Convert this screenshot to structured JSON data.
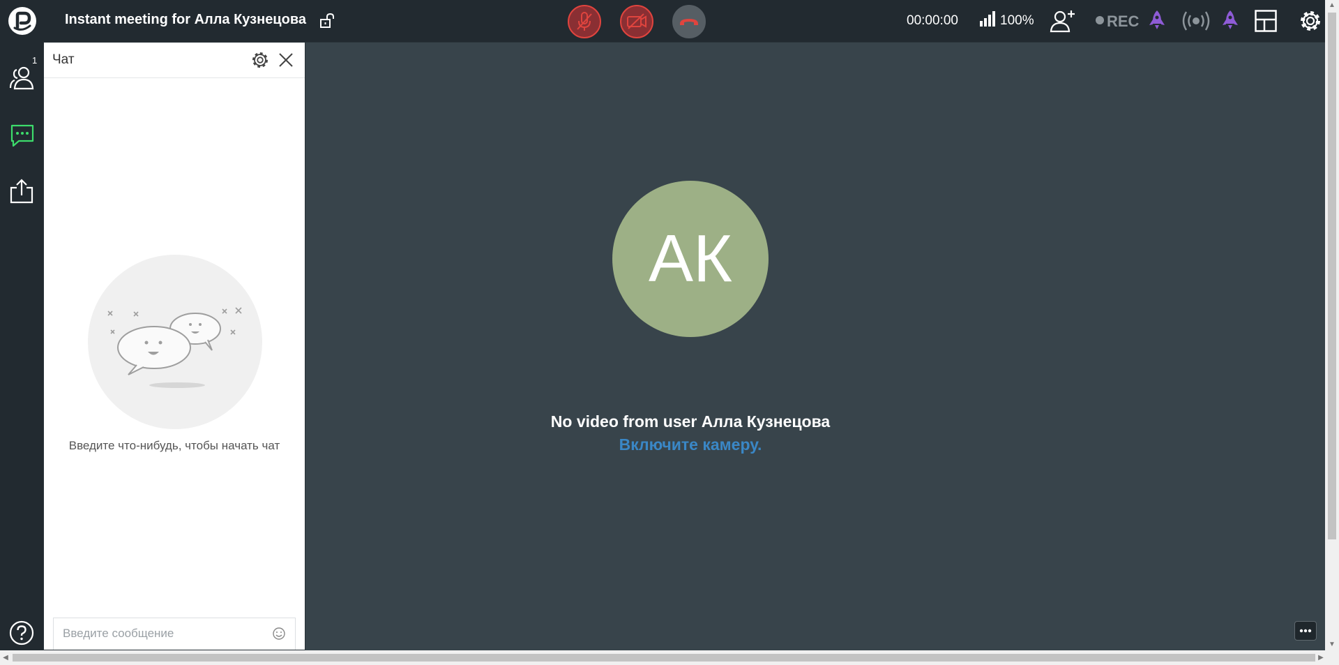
{
  "header": {
    "meeting_title": "Instant meeting for Алла Кузнецова",
    "timer": "00:00:00",
    "signal_percent": "100%",
    "rec_label": "REC",
    "icons": [
      "logo-icon",
      "unlock-icon",
      "mic-muted-icon",
      "camera-off-icon",
      "hang-up-icon",
      "signal-bars-icon",
      "add-user-icon",
      "rocket-icon",
      "broadcast-icon",
      "layout-icon",
      "settings-icon"
    ]
  },
  "sidebar": {
    "participants_count": "1",
    "items": [
      {
        "name": "participants",
        "icon": "participants-icon"
      },
      {
        "name": "chat",
        "icon": "chat-icon",
        "active": true
      },
      {
        "name": "share",
        "icon": "share-icon"
      },
      {
        "name": "help",
        "icon": "help-icon"
      }
    ]
  },
  "chat": {
    "title": "Чат",
    "empty_text": "Введите что-нибудь, чтобы начать чат",
    "input_placeholder": "Введите сообщение"
  },
  "main": {
    "avatar_initials": "АК",
    "no_video_text": "No video from user Алла Кузнецова",
    "enable_camera_link": "Включите камеру."
  },
  "colors": {
    "topbar": "#222a30",
    "main_bg": "#38444b",
    "avatar_bg": "#9db086",
    "danger": "#e0443e",
    "link": "#3a87c6",
    "active_green": "#3ddc6b",
    "rocket_purple": "#8e5bd6"
  }
}
